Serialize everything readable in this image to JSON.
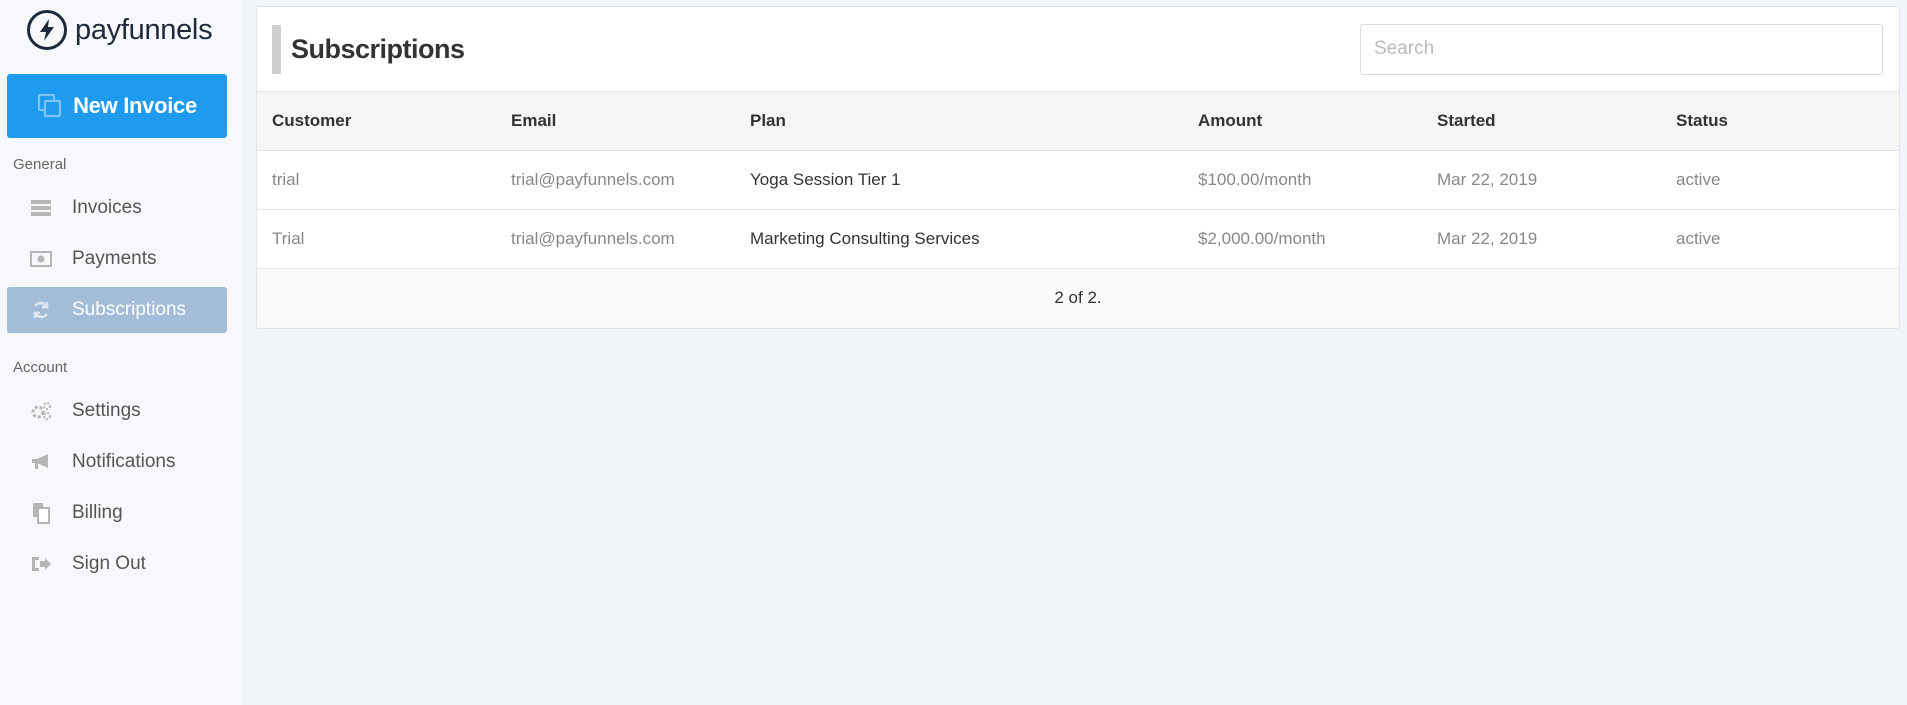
{
  "brand": {
    "name": "payfunnels"
  },
  "sidebar": {
    "new_invoice_label": "New Invoice",
    "general_label": "General",
    "general_items": [
      {
        "label": "Invoices",
        "icon": "invoices-icon"
      },
      {
        "label": "Payments",
        "icon": "payments-icon"
      },
      {
        "label": "Subscriptions",
        "icon": "refresh-icon",
        "active": true
      }
    ],
    "account_label": "Account",
    "account_items": [
      {
        "label": "Settings",
        "icon": "gears-icon"
      },
      {
        "label": "Notifications",
        "icon": "megaphone-icon"
      },
      {
        "label": "Billing",
        "icon": "billing-icon"
      },
      {
        "label": "Sign Out",
        "icon": "sign-out-icon"
      }
    ]
  },
  "main": {
    "title": "Subscriptions",
    "search": {
      "placeholder": "Search",
      "value": ""
    },
    "table": {
      "columns": [
        "Customer",
        "Email",
        "Plan",
        "Amount",
        "Started",
        "Status"
      ],
      "rows": [
        [
          "trial",
          "trial@payfunnels.com",
          "Yoga Session Tier 1",
          "$100.00/month",
          "Mar 22, 2019",
          "active"
        ],
        [
          "Trial",
          "trial@payfunnels.com",
          "Marketing Consulting Services",
          "$2,000.00/month",
          "Mar 22, 2019",
          "active"
        ]
      ]
    },
    "pagination": "2 of 2."
  },
  "colors": {
    "accent": "#1e9bef",
    "active_nav": "#a3bdd8",
    "brand_dark": "#1e2a3a"
  }
}
